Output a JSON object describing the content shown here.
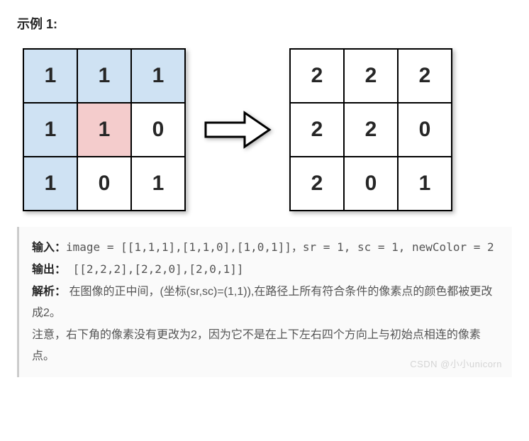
{
  "title": "示例 1:",
  "left_grid": [
    [
      {
        "v": "1",
        "c": "blue"
      },
      {
        "v": "1",
        "c": "blue"
      },
      {
        "v": "1",
        "c": "blue"
      }
    ],
    [
      {
        "v": "1",
        "c": "blue"
      },
      {
        "v": "1",
        "c": "pink"
      },
      {
        "v": "0",
        "c": ""
      }
    ],
    [
      {
        "v": "1",
        "c": "blue"
      },
      {
        "v": "0",
        "c": ""
      },
      {
        "v": "1",
        "c": ""
      }
    ]
  ],
  "right_grid": [
    [
      {
        "v": "2",
        "c": ""
      },
      {
        "v": "2",
        "c": ""
      },
      {
        "v": "2",
        "c": ""
      }
    ],
    [
      {
        "v": "2",
        "c": ""
      },
      {
        "v": "2",
        "c": ""
      },
      {
        "v": "0",
        "c": ""
      }
    ],
    [
      {
        "v": "2",
        "c": ""
      },
      {
        "v": "0",
        "c": ""
      },
      {
        "v": "1",
        "c": ""
      }
    ]
  ],
  "labels": {
    "input": "输入：",
    "output": "输出：",
    "explain": "解析："
  },
  "input_text": "image = [[1,1,1],[1,1,0],[1,0,1]]，sr = 1, sc = 1, newColor = 2",
  "output_text": " [[2,2,2],[2,2,0],[2,0,1]]",
  "explain_line1": " 在图像的正中间，(坐标(sr,sc)=(1,1)),在路径上所有符合条件的像素点的颜色都被更改成2。",
  "explain_line2": "注意，右下角的像素没有更改为2，因为它不是在上下左右四个方向上与初始点相连的像素点。",
  "watermark": "CSDN @小小unicorn",
  "chart_data": {
    "type": "table",
    "title": "flood-fill transformation 3×3 grid",
    "input_grid": [
      [
        1,
        1,
        1
      ],
      [
        1,
        1,
        0
      ],
      [
        1,
        0,
        1
      ]
    ],
    "output_grid": [
      [
        2,
        2,
        2
      ],
      [
        2,
        2,
        0
      ],
      [
        2,
        0,
        1
      ]
    ],
    "start": {
      "sr": 1,
      "sc": 1
    },
    "newColor": 2,
    "highlighted_blue_cells": [
      [
        0,
        0
      ],
      [
        0,
        1
      ],
      [
        0,
        2
      ],
      [
        1,
        0
      ],
      [
        2,
        0
      ]
    ],
    "highlighted_pink_cells": [
      [
        1,
        1
      ]
    ]
  }
}
